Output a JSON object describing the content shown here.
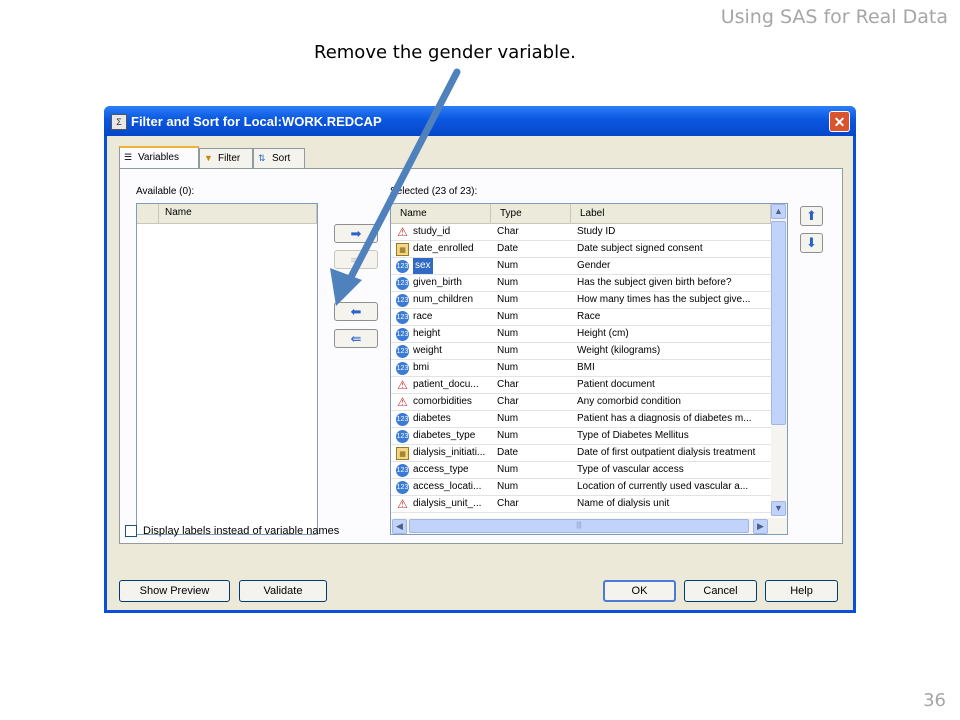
{
  "slide": {
    "header": "Using SAS for Real Data",
    "instruction": "Remove the gender variable.",
    "page_number": "36"
  },
  "dialog": {
    "title": "Filter and Sort for Local:WORK.REDCAP",
    "close_label": "✕",
    "tabs": [
      {
        "label": "Variables",
        "icon": "variables-tab-icon",
        "active": true
      },
      {
        "label": "Filter",
        "icon": "filter-funnel-icon",
        "active": false
      },
      {
        "label": "Sort",
        "icon": "sort-icon",
        "active": false
      }
    ],
    "available": {
      "label": "Available (0):",
      "column": "Name"
    },
    "move_buttons": [
      "add-selected",
      "add-all",
      "remove-selected",
      "remove-all"
    ],
    "selected": {
      "label": "Selected (23 of 23):",
      "columns": [
        "Name",
        "Type",
        "Label"
      ],
      "rows": [
        {
          "name": "study_id",
          "type": "Char",
          "label": "Study ID",
          "icon": "char"
        },
        {
          "name": "date_enrolled",
          "type": "Date",
          "label": "Date subject signed consent",
          "icon": "date"
        },
        {
          "name": "sex",
          "type": "Num",
          "label": "Gender",
          "icon": "num"
        },
        {
          "name": "given_birth",
          "type": "Num",
          "label": "Has the subject given birth before?",
          "icon": "num"
        },
        {
          "name": "num_children",
          "type": "Num",
          "label": "How many times has the subject give...",
          "icon": "num"
        },
        {
          "name": "race",
          "type": "Num",
          "label": "Race",
          "icon": "num"
        },
        {
          "name": "height",
          "type": "Num",
          "label": "Height (cm)",
          "icon": "num"
        },
        {
          "name": "weight",
          "type": "Num",
          "label": "Weight (kilograms)",
          "icon": "num"
        },
        {
          "name": "bmi",
          "type": "Num",
          "label": "BMI",
          "icon": "num"
        },
        {
          "name": "patient_docu...",
          "type": "Char",
          "label": "Patient document",
          "icon": "char"
        },
        {
          "name": "comorbidities",
          "type": "Char",
          "label": "Any comorbid condition",
          "icon": "char"
        },
        {
          "name": "diabetes",
          "type": "Num",
          "label": "Patient has a diagnosis of diabetes m...",
          "icon": "num"
        },
        {
          "name": "diabetes_type",
          "type": "Num",
          "label": "Type of Diabetes Mellitus",
          "icon": "num"
        },
        {
          "name": "dialysis_initiati...",
          "type": "Date",
          "label": "Date of first outpatient dialysis treatment",
          "icon": "date"
        },
        {
          "name": "access_type",
          "type": "Num",
          "label": "Type of vascular access",
          "icon": "num"
        },
        {
          "name": "access_locati...",
          "type": "Num",
          "label": "Location of currently used vascular a...",
          "icon": "num"
        },
        {
          "name": "dialysis_unit_...",
          "type": "Char",
          "label": "Name of dialysis unit",
          "icon": "char"
        }
      ]
    },
    "display_labels_text": "Display labels instead of variable names",
    "buttons": {
      "show_preview": "Show Preview",
      "validate": "Validate",
      "ok": "OK",
      "cancel": "Cancel",
      "help": "Help"
    },
    "colors": {
      "title_bar": "#0a57e0",
      "selection": "#316ac5",
      "annotation_arrow": "#4f81bd"
    }
  }
}
